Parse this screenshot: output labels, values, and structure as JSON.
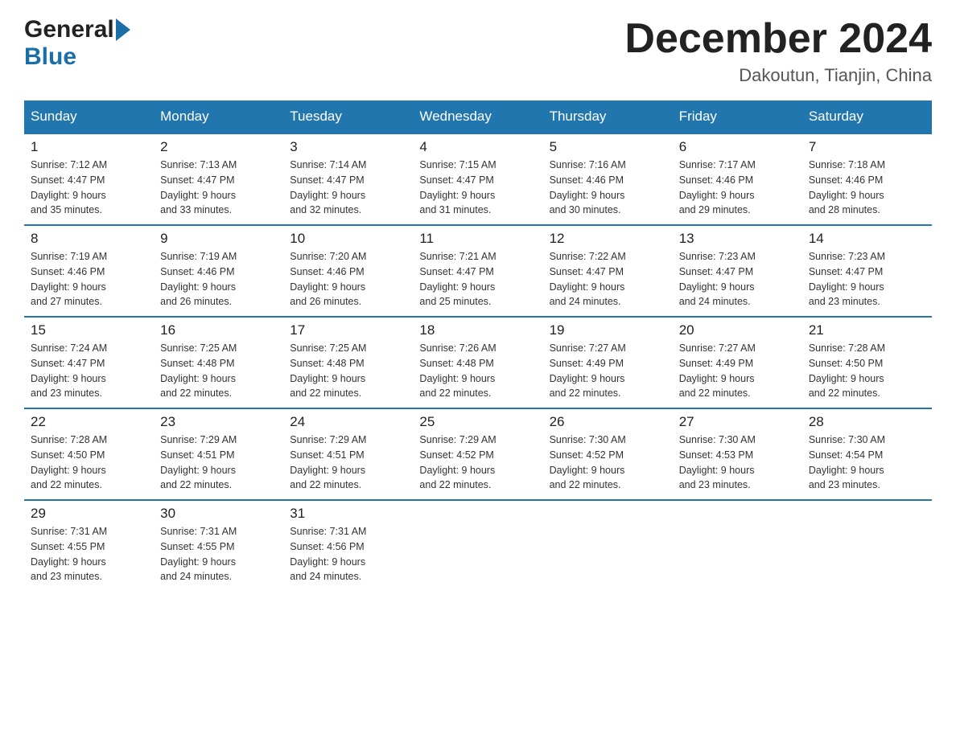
{
  "header": {
    "logo_general": "General",
    "logo_blue": "Blue",
    "month_title": "December 2024",
    "location": "Dakoutun, Tianjin, China"
  },
  "days_of_week": [
    "Sunday",
    "Monday",
    "Tuesday",
    "Wednesday",
    "Thursday",
    "Friday",
    "Saturday"
  ],
  "weeks": [
    [
      {
        "day": "1",
        "sunrise": "7:12 AM",
        "sunset": "4:47 PM",
        "daylight": "9 hours and 35 minutes."
      },
      {
        "day": "2",
        "sunrise": "7:13 AM",
        "sunset": "4:47 PM",
        "daylight": "9 hours and 33 minutes."
      },
      {
        "day": "3",
        "sunrise": "7:14 AM",
        "sunset": "4:47 PM",
        "daylight": "9 hours and 32 minutes."
      },
      {
        "day": "4",
        "sunrise": "7:15 AM",
        "sunset": "4:47 PM",
        "daylight": "9 hours and 31 minutes."
      },
      {
        "day": "5",
        "sunrise": "7:16 AM",
        "sunset": "4:46 PM",
        "daylight": "9 hours and 30 minutes."
      },
      {
        "day": "6",
        "sunrise": "7:17 AM",
        "sunset": "4:46 PM",
        "daylight": "9 hours and 29 minutes."
      },
      {
        "day": "7",
        "sunrise": "7:18 AM",
        "sunset": "4:46 PM",
        "daylight": "9 hours and 28 minutes."
      }
    ],
    [
      {
        "day": "8",
        "sunrise": "7:19 AM",
        "sunset": "4:46 PM",
        "daylight": "9 hours and 27 minutes."
      },
      {
        "day": "9",
        "sunrise": "7:19 AM",
        "sunset": "4:46 PM",
        "daylight": "9 hours and 26 minutes."
      },
      {
        "day": "10",
        "sunrise": "7:20 AM",
        "sunset": "4:46 PM",
        "daylight": "9 hours and 26 minutes."
      },
      {
        "day": "11",
        "sunrise": "7:21 AM",
        "sunset": "4:47 PM",
        "daylight": "9 hours and 25 minutes."
      },
      {
        "day": "12",
        "sunrise": "7:22 AM",
        "sunset": "4:47 PM",
        "daylight": "9 hours and 24 minutes."
      },
      {
        "day": "13",
        "sunrise": "7:23 AM",
        "sunset": "4:47 PM",
        "daylight": "9 hours and 24 minutes."
      },
      {
        "day": "14",
        "sunrise": "7:23 AM",
        "sunset": "4:47 PM",
        "daylight": "9 hours and 23 minutes."
      }
    ],
    [
      {
        "day": "15",
        "sunrise": "7:24 AM",
        "sunset": "4:47 PM",
        "daylight": "9 hours and 23 minutes."
      },
      {
        "day": "16",
        "sunrise": "7:25 AM",
        "sunset": "4:48 PM",
        "daylight": "9 hours and 22 minutes."
      },
      {
        "day": "17",
        "sunrise": "7:25 AM",
        "sunset": "4:48 PM",
        "daylight": "9 hours and 22 minutes."
      },
      {
        "day": "18",
        "sunrise": "7:26 AM",
        "sunset": "4:48 PM",
        "daylight": "9 hours and 22 minutes."
      },
      {
        "day": "19",
        "sunrise": "7:27 AM",
        "sunset": "4:49 PM",
        "daylight": "9 hours and 22 minutes."
      },
      {
        "day": "20",
        "sunrise": "7:27 AM",
        "sunset": "4:49 PM",
        "daylight": "9 hours and 22 minutes."
      },
      {
        "day": "21",
        "sunrise": "7:28 AM",
        "sunset": "4:50 PM",
        "daylight": "9 hours and 22 minutes."
      }
    ],
    [
      {
        "day": "22",
        "sunrise": "7:28 AM",
        "sunset": "4:50 PM",
        "daylight": "9 hours and 22 minutes."
      },
      {
        "day": "23",
        "sunrise": "7:29 AM",
        "sunset": "4:51 PM",
        "daylight": "9 hours and 22 minutes."
      },
      {
        "day": "24",
        "sunrise": "7:29 AM",
        "sunset": "4:51 PM",
        "daylight": "9 hours and 22 minutes."
      },
      {
        "day": "25",
        "sunrise": "7:29 AM",
        "sunset": "4:52 PM",
        "daylight": "9 hours and 22 minutes."
      },
      {
        "day": "26",
        "sunrise": "7:30 AM",
        "sunset": "4:52 PM",
        "daylight": "9 hours and 22 minutes."
      },
      {
        "day": "27",
        "sunrise": "7:30 AM",
        "sunset": "4:53 PM",
        "daylight": "9 hours and 23 minutes."
      },
      {
        "day": "28",
        "sunrise": "7:30 AM",
        "sunset": "4:54 PM",
        "daylight": "9 hours and 23 minutes."
      }
    ],
    [
      {
        "day": "29",
        "sunrise": "7:31 AM",
        "sunset": "4:55 PM",
        "daylight": "9 hours and 23 minutes."
      },
      {
        "day": "30",
        "sunrise": "7:31 AM",
        "sunset": "4:55 PM",
        "daylight": "9 hours and 24 minutes."
      },
      {
        "day": "31",
        "sunrise": "7:31 AM",
        "sunset": "4:56 PM",
        "daylight": "9 hours and 24 minutes."
      },
      null,
      null,
      null,
      null
    ]
  ],
  "labels": {
    "sunrise": "Sunrise:",
    "sunset": "Sunset:",
    "daylight": "Daylight:"
  }
}
